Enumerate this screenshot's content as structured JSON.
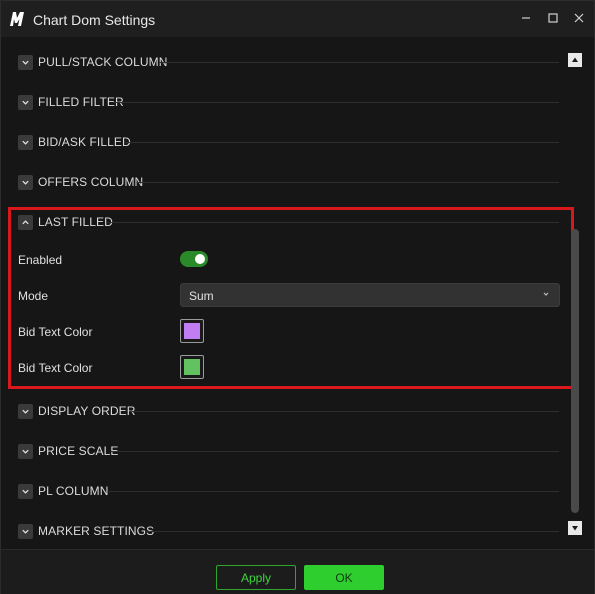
{
  "window": {
    "title": "Chart Dom Settings",
    "logo_icon": "app-logo-icon",
    "controls": {
      "minimize_icon": "minimize-icon",
      "maximize_icon": "maximize-icon",
      "close_icon": "close-icon"
    }
  },
  "sections": [
    {
      "label": "PULL/STACK COLUMN",
      "expanded": false
    },
    {
      "label": "FILLED FILTER",
      "expanded": false
    },
    {
      "label": "BID/ASK FILLED",
      "expanded": false
    },
    {
      "label": "OFFERS COLUMN",
      "expanded": false
    },
    {
      "label": "LAST FILLED",
      "expanded": true
    },
    {
      "label": "DISPLAY ORDER",
      "expanded": false
    },
    {
      "label": "PRICE SCALE",
      "expanded": false
    },
    {
      "label": "PL COLUMN",
      "expanded": false
    },
    {
      "label": "MARKER SETTINGS",
      "expanded": false
    }
  ],
  "last_filled": {
    "enabled_label": "Enabled",
    "enabled": true,
    "mode_label": "Mode",
    "mode_value": "Sum",
    "bid_text_color_label": "Bid Text Color",
    "bid_text_color": "#c17ef3",
    "bid_text_color_2_label": "Bid Text Color",
    "bid_text_color_2": "#62c262"
  },
  "footer": {
    "apply_label": "Apply",
    "ok_label": "OK"
  },
  "colors": {
    "accent": "#2fce2f",
    "highlight_border": "#d8181c",
    "toggle_on": "#2a8a2a"
  }
}
